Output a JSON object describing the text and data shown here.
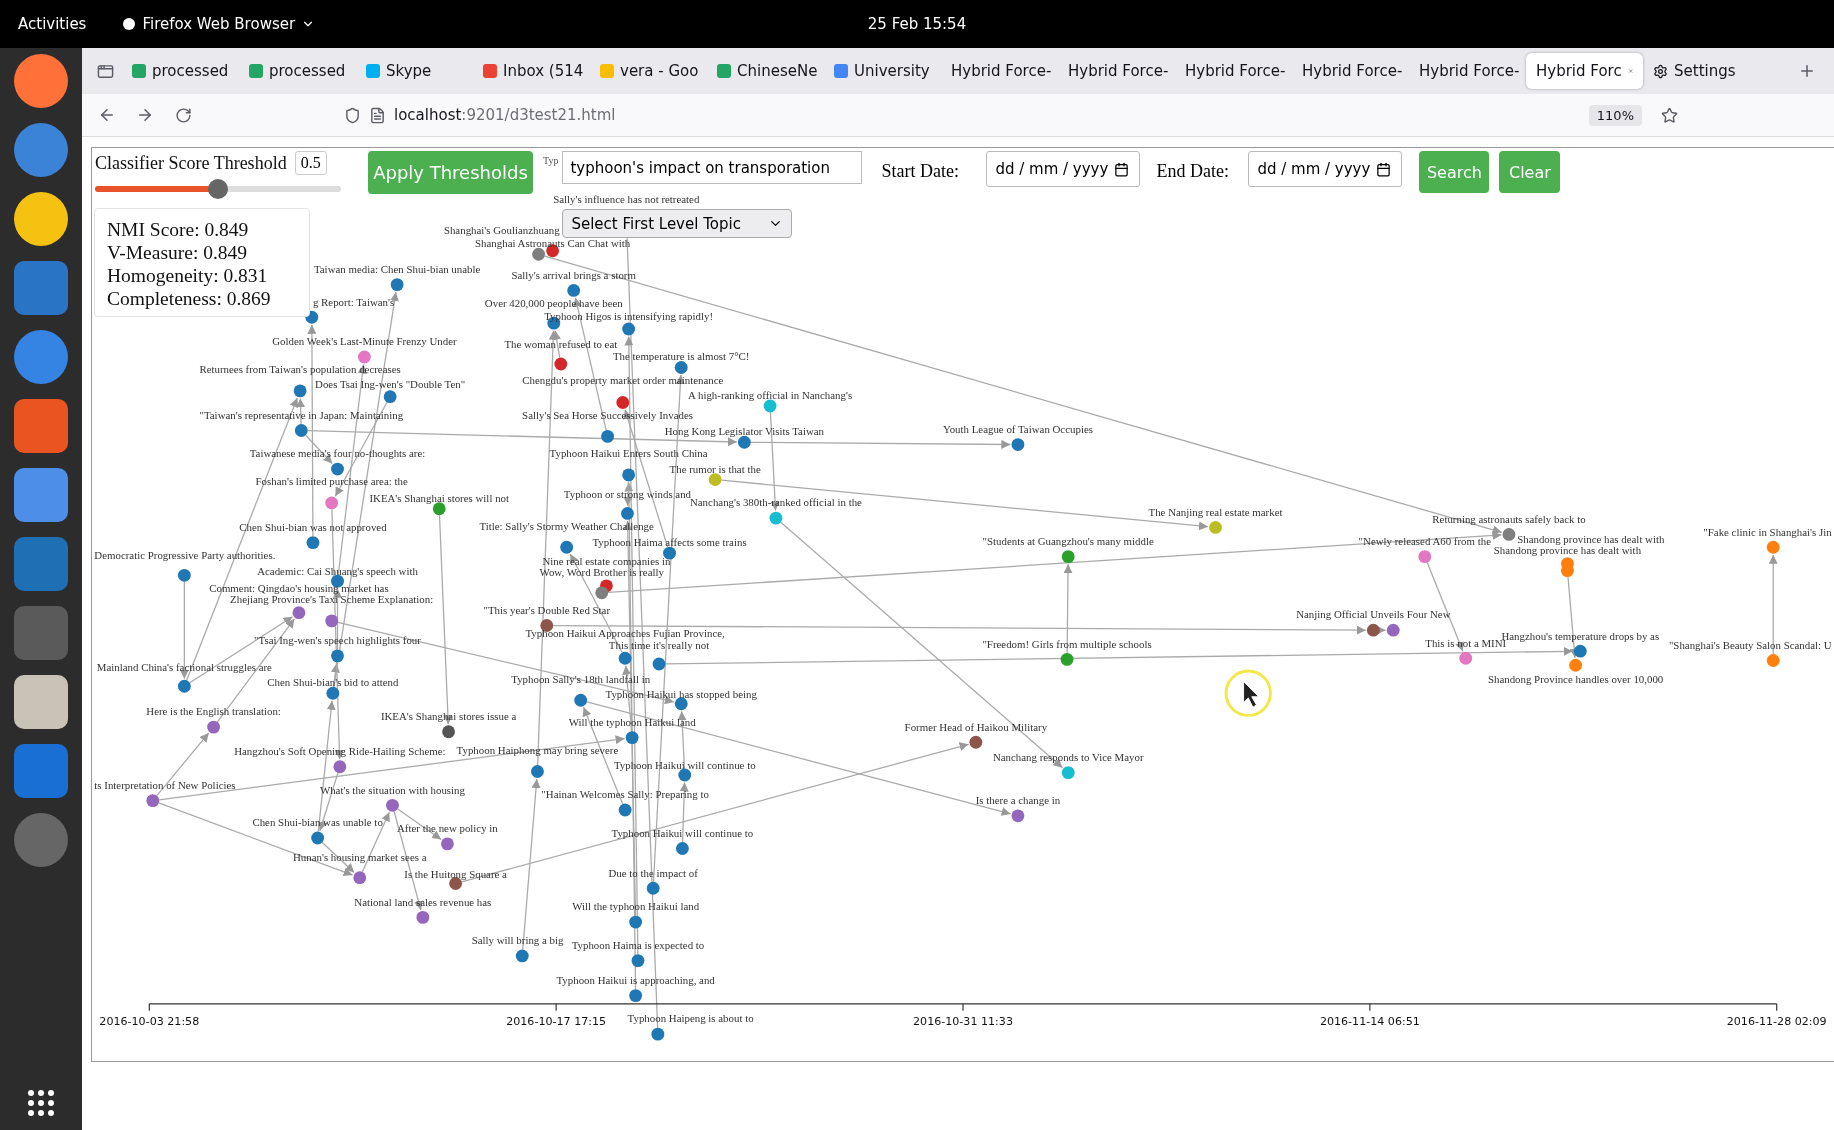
{
  "top_bar": {
    "activities": "Activities",
    "app_menu": "Firefox Web Browser",
    "clock": "25 Feb 15:54"
  },
  "tabs": [
    {
      "label": "processed",
      "kind": "sheet",
      "selected": false
    },
    {
      "label": "processed",
      "kind": "sheet",
      "selected": false
    },
    {
      "label": "Skype",
      "kind": "skype",
      "selected": false
    },
    {
      "label": "Inbox (514",
      "kind": "mail",
      "selected": false
    },
    {
      "label": "vera - Goo",
      "kind": "drive",
      "selected": false
    },
    {
      "label": "ChineseNe",
      "kind": "sheet",
      "selected": false
    },
    {
      "label": "University",
      "kind": "doc",
      "selected": false
    },
    {
      "label": "Hybrid Force-",
      "kind": "plain",
      "selected": false
    },
    {
      "label": "Hybrid Force-",
      "kind": "plain",
      "selected": false
    },
    {
      "label": "Hybrid Force-",
      "kind": "plain",
      "selected": false
    },
    {
      "label": "Hybrid Force-",
      "kind": "plain",
      "selected": false
    },
    {
      "label": "Hybrid Force-",
      "kind": "plain",
      "selected": false
    },
    {
      "label": "Hybrid Forc",
      "kind": "plain",
      "selected": true
    },
    {
      "label": "Settings",
      "kind": "settings",
      "selected": false
    }
  ],
  "address_bar": {
    "host": "localhost",
    "path": ":9201/d3test21.html",
    "zoom": "110%"
  },
  "controls": {
    "threshold_label": "Classifier Score Threshold",
    "threshold_value": "0.5",
    "threshold": {
      "level": 0.5
    },
    "apply_button": "Apply Thresholds",
    "query_hint": "Typ",
    "query": "typhoon's impact on transporation",
    "topic_select": "Select First Level Topic",
    "start_label": "Start Date:",
    "start_placeholder": "dd / mm / yyyy",
    "end_label": "End Date:",
    "end_placeholder": "dd / mm / yyyy",
    "search_button": "Search",
    "clear_button": "Clear"
  },
  "metrics": [
    "NMI Score: 0.849",
    "V-Measure: 0.849",
    "Homogeneity: 0.831",
    "Completeness: 0.869"
  ],
  "graph": {
    "nodes": [
      {
        "label": "Sally's influence has not retreated"
      },
      {
        "label": "Shanghai's Goulianzhuang",
        "color": "#7f7f7f"
      },
      {
        "label": "Shanghai Astronauts Can Chat with",
        "color": "#d62728"
      },
      {
        "label": "Taiwan media: Chen Shui-bian unable",
        "color": "#1f77b4"
      },
      {
        "label": "Sally's arrival brings a storm",
        "color": "#1f77b4"
      },
      {
        "label": "g Report: Taiwan's",
        "color": "#1f77b4"
      },
      {
        "label": "Over 420,000 people have been",
        "color": "#1f77b4"
      },
      {
        "label": "Typhoon Higos is intensifying rapidly!",
        "color": "#1f77b4"
      },
      {
        "label": "Golden Week's Last-Minute Frenzy Under",
        "color": "#e377c2"
      },
      {
        "label": "The woman refused to eat",
        "color": "#d62728"
      },
      {
        "label": "The temperature is almost 7°C!",
        "color": "#1f77b4"
      },
      {
        "label": "Returnees from Taiwan's population decreases",
        "color": "#1f77b4"
      },
      {
        "label": "Does Tsai Ing-wen's \"Double Ten\"",
        "color": "#1f77b4"
      },
      {
        "label": "Chengdu's property market order maintenance",
        "color": "#d62728"
      },
      {
        "label": "A high-ranking official in Nanchang's",
        "color": "#17becf"
      },
      {
        "label": "\"Taiwan's representative in Japan: Maintaining",
        "color": "#1f77b4"
      },
      {
        "label": "Sally's Sea Horse Successively Invades",
        "color": "#1f77b4"
      },
      {
        "label": "Hong Kong Legislator Visits Taiwan",
        "color": "#1f77b4"
      },
      {
        "label": "Youth League of Taiwan Occupies",
        "color": "#1f77b4"
      },
      {
        "label": "Taiwanese media's four no-thoughts are:",
        "color": "#1f77b4"
      },
      {
        "label": "Typhoon Haikui Enters South China",
        "color": "#1f77b4"
      },
      {
        "label": "The rumor is that the",
        "color": "#bcbd22"
      },
      {
        "label": "Foshan's limited purchase area: the",
        "color": "#e377c2"
      },
      {
        "label": "IKEA's Shanghai stores will not",
        "color": "#2ca02c"
      },
      {
        "label": "Typhoon or strong winds and",
        "color": "#1f77b4"
      },
      {
        "label": "Nanchang's 380th-ranked official in the",
        "color": "#17becf"
      },
      {
        "label": "The Nanjing real estate market",
        "color": "#bcbd22"
      },
      {
        "label": "Returning astronauts safely back to",
        "color": "#7f7f7f"
      },
      {
        "label": "Chen Shui-bian was not approved",
        "color": "#1f77b4"
      },
      {
        "label": "Title: Sally's Stormy Weather Challenge",
        "color": "#1f77b4"
      },
      {
        "label": "Typhoon Haima affects some trains",
        "color": "#1f77b4"
      },
      {
        "label": "\"Students at Guangzhou's many middle",
        "color": "#2ca02c"
      },
      {
        "label": "\"Newly released A60 from the",
        "color": "#e377c2"
      },
      {
        "label": "Shandong province has dealt with",
        "color": "#ff7f0e"
      },
      {
        "label": "Shandong province has dealt with",
        "color": "#ff7f0e"
      },
      {
        "label": "\"Fake clinic in Shanghai's Jin",
        "color": "#ff7f0e"
      },
      {
        "label": "Democratic Progressive Party authorities.",
        "color": "#1f77b4"
      },
      {
        "label": "Academic: Cai Shuang's speech with",
        "color": "#1f77b4"
      },
      {
        "label": "Nine real estate companies in",
        "color": "#d62728"
      },
      {
        "label": "Wow, Word Brother is really",
        "color": "#7f7f7f"
      },
      {
        "label": "Comment: Qingdao's housing market has",
        "color": "#9467bd"
      },
      {
        "label": "Zhejiang Province's Taxi Scheme Explanation:",
        "color": "#9467bd"
      },
      {
        "label": "\"This year's Double Red Star",
        "color": "#8c564b"
      },
      {
        "label": "Nanjing Official Unveils Four New",
        "color": "#8c564b"
      },
      {
        "color": "#9467bd"
      },
      {
        "label": "Typhoon Haikui Approaches Fujian Province,",
        "color": "#1f77b4"
      },
      {
        "label": "This time it's really not",
        "color": "#1f77b4"
      },
      {
        "label": "\"Freedom! Girls from multiple schools",
        "color": "#2ca02c"
      },
      {
        "label": "This is not a MINI",
        "color": "#e377c2"
      },
      {
        "label": "Hangzhou's temperature drops by as",
        "color": "#1f77b4"
      },
      {
        "label": "Shandong Province handles over 10,000",
        "color": "#ff7f0e"
      },
      {
        "label": "\"Shanghai's Beauty Salon Scandal: U",
        "color": "#ff7f0e"
      },
      {
        "label": "\"Tsai Ing-wen's speech highlights four",
        "color": "#1f77b4"
      },
      {
        "label": "Mainland China's factional struggles are",
        "color": "#1f77b4"
      },
      {
        "label": "Chen Shui-bian's bid to attend",
        "color": "#1f77b4"
      },
      {
        "label": "Typhoon Sally's 18th landfall in",
        "color": "#1f77b4"
      },
      {
        "label": "Typhoon Haikui has stopped being",
        "color": "#1f77b4"
      },
      {
        "label": "Here is the English translation:",
        "color": "#9467bd"
      },
      {
        "label": "IKEA's Shanghai stores issue a",
        "color": "#555555"
      },
      {
        "label": "Will the typhoon Haikui land",
        "color": "#1f77b4"
      },
      {
        "label": "Former Head of Haikou Military",
        "color": "#8c564b"
      },
      {
        "label": "Hangzhou's Soft Opening Ride-Hailing Scheme:",
        "color": "#9467bd"
      },
      {
        "label": "Typhoon Haiphong may bring severe",
        "color": "#1f77b4"
      },
      {
        "label": "Typhoon Haikui will continue to",
        "color": "#1f77b4"
      },
      {
        "label": "Nanchang responds to Vice Mayor",
        "color": "#17becf"
      },
      {
        "label": "ts Interpretation of New Policies",
        "color": "#9467bd"
      },
      {
        "label": "What's the situation with housing",
        "color": "#9467bd"
      },
      {
        "label": "\"Hainan Welcomes Sally: Preparing to",
        "color": "#1f77b4"
      },
      {
        "label": "Is there a change in",
        "color": "#9467bd"
      },
      {
        "label": "Chen Shui-bian was unable to",
        "color": "#1f77b4"
      },
      {
        "label": "After the new policy in",
        "color": "#9467bd"
      },
      {
        "label": "Typhoon Haikui will continue to",
        "color": "#1f77b4"
      },
      {
        "label": "Hunan's housing market sees a",
        "color": "#9467bd"
      },
      {
        "label": "Is the Huitong Square a",
        "color": "#8c564b"
      },
      {
        "label": "Due to the impact of",
        "color": "#1f77b4"
      },
      {
        "label": "National land sales revenue has",
        "color": "#9467bd"
      },
      {
        "label": "Will the typhoon Haikui land",
        "color": "#1f77b4"
      },
      {
        "label": "Sally will bring a big",
        "color": "#1f77b4"
      },
      {
        "label": "Typhoon Haima is expected to",
        "color": "#1f77b4"
      },
      {
        "label": "Typhoon Haikui is approaching, and",
        "color": "#1f77b4"
      },
      {
        "label": "Typhoon Haipeng is about to",
        "color": "#1f77b4"
      }
    ],
    "axis_ticks": [
      "2016-10-03 21:58",
      "2016-10-17 17:15",
      "2016-10-31 11:33",
      "2016-11-14 06:51",
      "2016-11-28 02:09"
    ]
  }
}
